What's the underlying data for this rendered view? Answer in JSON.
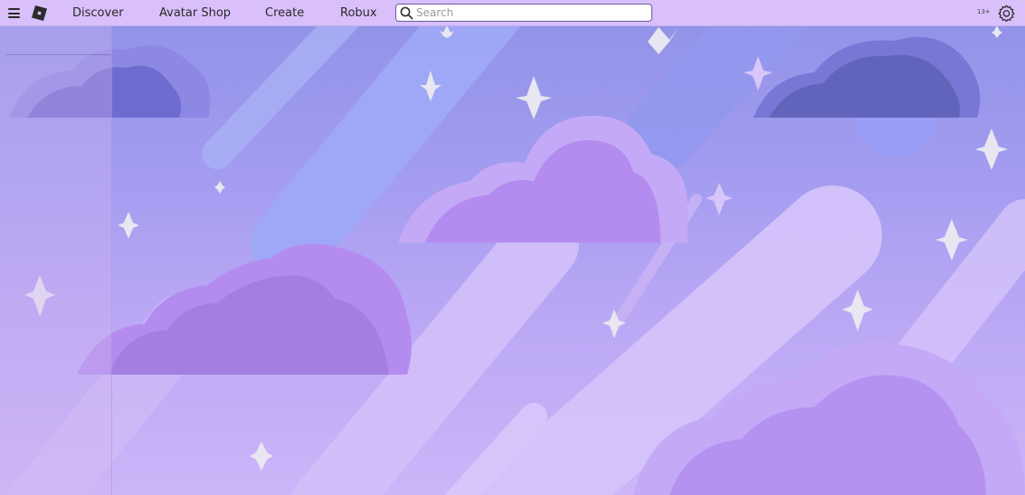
{
  "topbar": {
    "nav": [
      {
        "label": "Discover"
      },
      {
        "label": "Avatar Shop"
      },
      {
        "label": "Create"
      },
      {
        "label": "Robux"
      }
    ],
    "search": {
      "placeholder": "Search",
      "value": ""
    },
    "age_badge": "13+"
  },
  "icons": {
    "menu": "hamburger-menu-icon",
    "logo": "roblox-logo-icon",
    "search": "search-icon",
    "settings": "gear-icon"
  },
  "colors": {
    "topbar": "#d9c0fb",
    "background_top": "#8f92e6",
    "background_bottom": "#cbb6f8"
  }
}
